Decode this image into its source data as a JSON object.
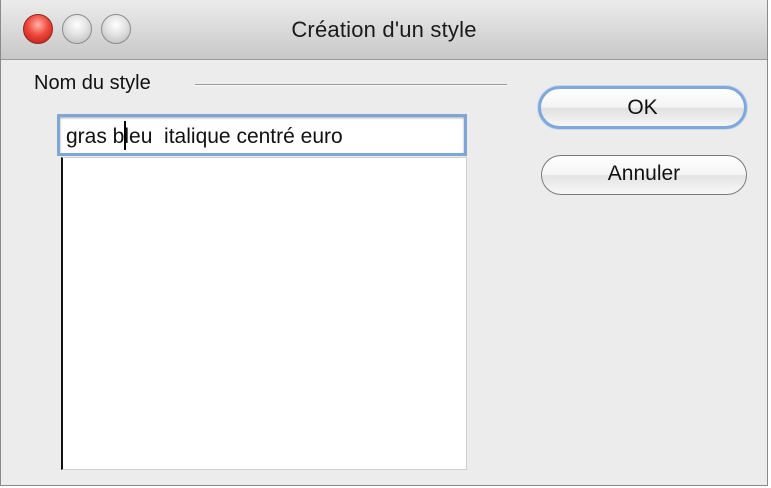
{
  "window": {
    "title": "Création d'un style"
  },
  "form": {
    "group_label": "Nom du style",
    "style_name_value": "gras bleu  italique centré euro",
    "style_list_items": []
  },
  "buttons": {
    "ok_label": "OK",
    "cancel_label": "Annuler"
  },
  "colors": {
    "focus_ring": "#7fa6d4",
    "close_button": "#e0443a",
    "window_bg": "#ececec"
  }
}
